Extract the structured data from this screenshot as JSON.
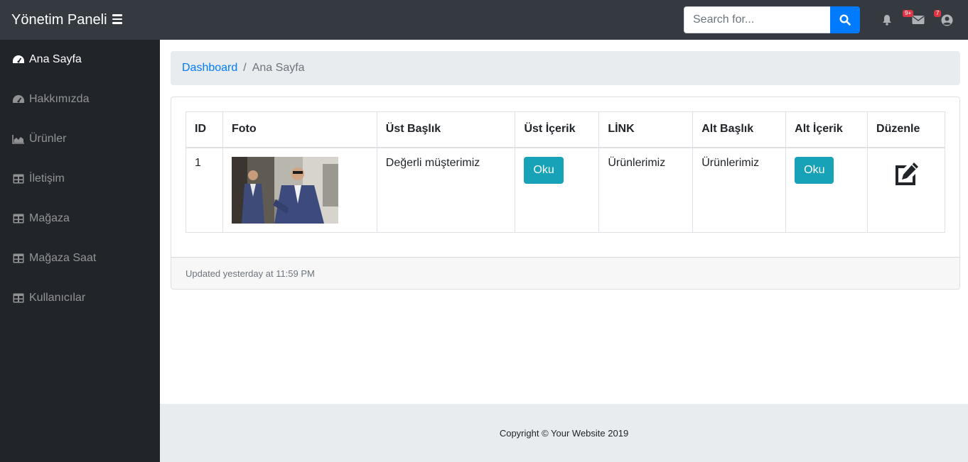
{
  "navbar": {
    "brand": "Yönetim Paneli",
    "search_placeholder": "Search for...",
    "alerts_badge": "9+",
    "messages_badge": "7",
    "accent": "#007bff"
  },
  "sidebar": {
    "items": [
      {
        "label": "Ana Sayfa",
        "icon": "tachometer-icon",
        "active": true
      },
      {
        "label": "Hakkımızda",
        "icon": "tachometer-icon"
      },
      {
        "label": "Ürünler",
        "icon": "area-chart-icon"
      },
      {
        "label": "İletişim",
        "icon": "table-icon"
      },
      {
        "label": "Mağaza",
        "icon": "table-icon"
      },
      {
        "label": "Mağaza Saat",
        "icon": "table-icon"
      },
      {
        "label": "Kullanıcılar",
        "icon": "table-icon"
      }
    ]
  },
  "breadcrumb": {
    "link": "Dashboard",
    "separator": "/",
    "current": "Ana Sayfa"
  },
  "table": {
    "headers": [
      "ID",
      "Foto",
      "Üst Başlık",
      "Üst İçerik",
      "LİNK",
      "Alt Başlık",
      "Alt İçerik",
      "Düzenle"
    ],
    "rows": [
      {
        "id": "1",
        "photo": "photo of man in suit",
        "ust_baslik": "Değerli müşterimiz",
        "ust_icerik_button": "Oku",
        "link": "Ürünlerimiz",
        "alt_baslik": "Ürünlerimiz",
        "alt_icerik_button": "Oku",
        "edit_icon": "edit-icon"
      }
    ]
  },
  "card_footer": "Updated yesterday at 11:59 PM",
  "footer": "Copyright © Your Website 2019"
}
